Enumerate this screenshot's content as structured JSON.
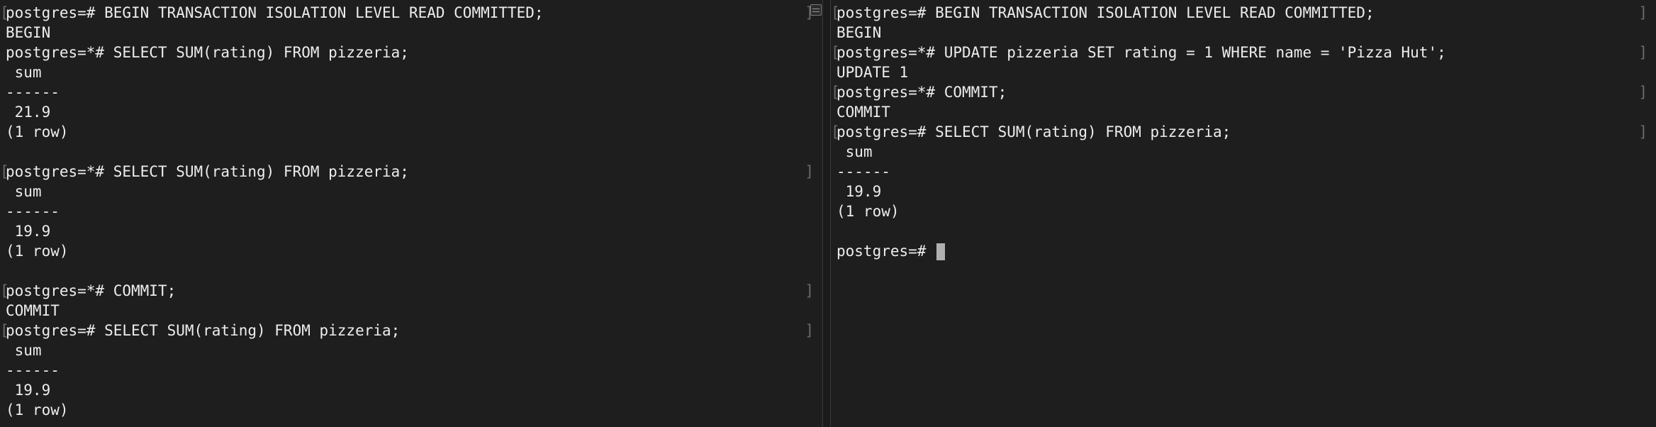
{
  "left_pane": {
    "lines": [
      {
        "text": "postgres=# BEGIN TRANSACTION ISOLATION LEVEL READ COMMITTED;",
        "mark": true
      },
      {
        "text": "BEGIN",
        "mark": false
      },
      {
        "text": "postgres=*# SELECT SUM(rating) FROM pizzeria;",
        "mark": false
      },
      {
        "text": " sum",
        "mark": false
      },
      {
        "text": "------",
        "mark": false
      },
      {
        "text": " 21.9",
        "mark": false
      },
      {
        "text": "(1 row)",
        "mark": false
      },
      {
        "text": "",
        "mark": false
      },
      {
        "text": "postgres=*# SELECT SUM(rating) FROM pizzeria;",
        "mark": true
      },
      {
        "text": " sum",
        "mark": false
      },
      {
        "text": "------",
        "mark": false
      },
      {
        "text": " 19.9",
        "mark": false
      },
      {
        "text": "(1 row)",
        "mark": false
      },
      {
        "text": "",
        "mark": false
      },
      {
        "text": "postgres=*# COMMIT;",
        "mark": true
      },
      {
        "text": "COMMIT",
        "mark": false
      },
      {
        "text": "postgres=# SELECT SUM(rating) FROM pizzeria;",
        "mark": true
      },
      {
        "text": " sum",
        "mark": false
      },
      {
        "text": "------",
        "mark": false
      },
      {
        "text": " 19.9",
        "mark": false
      },
      {
        "text": "(1 row)",
        "mark": false
      }
    ]
  },
  "right_pane": {
    "lines": [
      {
        "text": "postgres=# BEGIN TRANSACTION ISOLATION LEVEL READ COMMITTED;",
        "mark": true
      },
      {
        "text": "BEGIN",
        "mark": false
      },
      {
        "text": "postgres=*# UPDATE pizzeria SET rating = 1 WHERE name = 'Pizza Hut';",
        "mark": true
      },
      {
        "text": "UPDATE 1",
        "mark": false
      },
      {
        "text": "postgres=*# COMMIT;",
        "mark": true
      },
      {
        "text": "COMMIT",
        "mark": false
      },
      {
        "text": "postgres=# SELECT SUM(rating) FROM pizzeria;",
        "mark": true
      },
      {
        "text": " sum",
        "mark": false
      },
      {
        "text": "------",
        "mark": false
      },
      {
        "text": " 19.9",
        "mark": false
      },
      {
        "text": "(1 row)",
        "mark": false
      },
      {
        "text": "",
        "mark": false
      }
    ],
    "prompt": "postgres=# "
  },
  "icons": {
    "split_left": "split-pane-icon",
    "split_right": "split-pane-icon"
  },
  "colors": {
    "background": "#1e1e1e",
    "text": "#ededed",
    "cursor": "#b0b0b0"
  }
}
